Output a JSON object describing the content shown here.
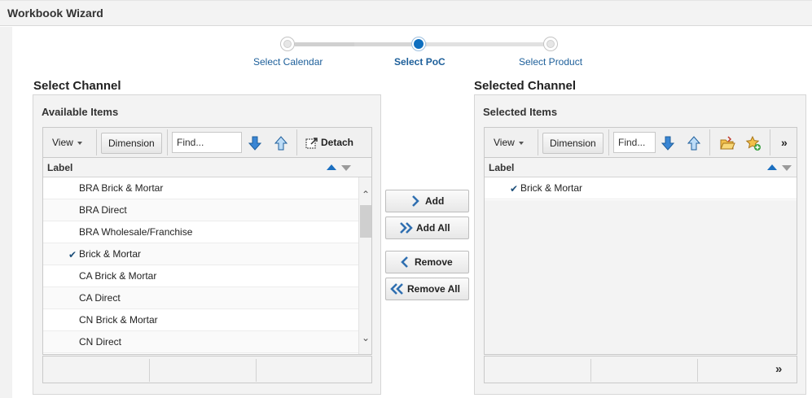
{
  "window": {
    "title": "Workbook Wizard"
  },
  "train": {
    "steps": [
      {
        "label": "Select Calendar",
        "state": "visited"
      },
      {
        "label": "Select PoC",
        "state": "current"
      },
      {
        "label": "Select Product",
        "state": "pending"
      }
    ]
  },
  "left": {
    "section_title": "Select Channel",
    "panel_title": "Available Items",
    "toolbar": {
      "view_label": "View",
      "dimension_label": "Dimension",
      "find_placeholder": "Find...",
      "detach_label": "Detach"
    },
    "column_label": "Label",
    "rows": [
      {
        "label": "BRA Brick & Mortar",
        "checked": false
      },
      {
        "label": "BRA Direct",
        "checked": false
      },
      {
        "label": "BRA Wholesale/Franchise",
        "checked": false
      },
      {
        "label": "Brick & Mortar",
        "checked": true
      },
      {
        "label": "CA Brick & Mortar",
        "checked": false
      },
      {
        "label": "CA Direct",
        "checked": false
      },
      {
        "label": "CN Brick & Mortar",
        "checked": false
      },
      {
        "label": "CN Direct",
        "checked": false
      }
    ]
  },
  "shuttle": {
    "add": "Add",
    "add_all": "Add All",
    "remove": "Remove",
    "remove_all": "Remove All"
  },
  "right": {
    "section_title": "Selected Channel",
    "panel_title": "Selected Items",
    "toolbar": {
      "view_label": "View",
      "dimension_label": "Dimension",
      "find_placeholder": "Find...",
      "more_label": "»"
    },
    "column_label": "Label",
    "rows": [
      {
        "label": "Brick & Mortar",
        "checked": true
      }
    ],
    "footer_more": "»"
  },
  "colors": {
    "accent": "#0f6fbf",
    "link": "#1d5f9a",
    "arrow_blue": "#3a86d4"
  }
}
